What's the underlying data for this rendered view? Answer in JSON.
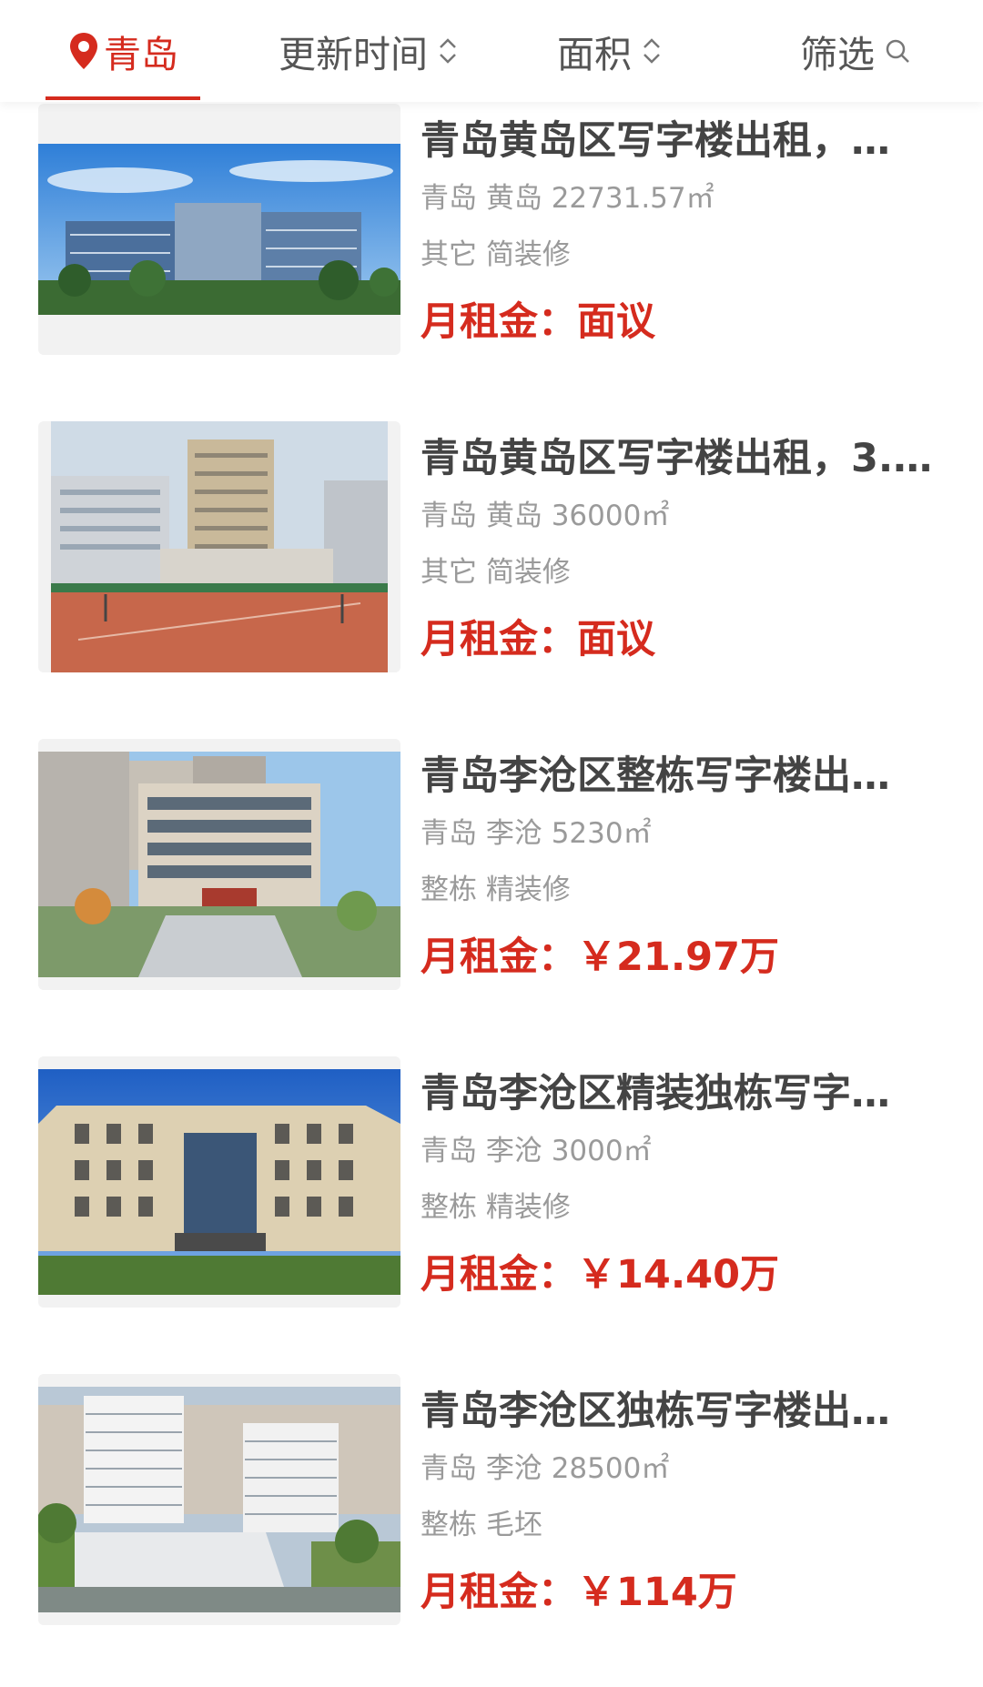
{
  "filter_bar": {
    "city": "青岛",
    "sort_update": "更新时间",
    "sort_area": "面积",
    "filter": "筛选",
    "accent_color": "#d52b1e"
  },
  "rent_label": "月租金：",
  "listings": [
    {
      "title": "青岛黄岛区写字楼出租，…",
      "location": "青岛 黄岛 22731.57㎡",
      "tags": "其它 简装修",
      "rent": "面议"
    },
    {
      "title": "青岛黄岛区写字楼出租，3.…",
      "location": "青岛 黄岛 36000㎡",
      "tags": "其它 简装修",
      "rent": "面议"
    },
    {
      "title": "青岛李沧区整栋写字楼出…",
      "location": "青岛 李沧 5230㎡",
      "tags": "整栋 精装修",
      "rent": "￥21.97万"
    },
    {
      "title": "青岛李沧区精装独栋写字…",
      "location": "青岛 李沧 3000㎡",
      "tags": "整栋 精装修",
      "rent": "￥14.40万"
    },
    {
      "title": "青岛李沧区独栋写字楼出…",
      "location": "青岛 李沧 28500㎡",
      "tags": "整栋 毛坯",
      "rent": "￥114万"
    }
  ]
}
